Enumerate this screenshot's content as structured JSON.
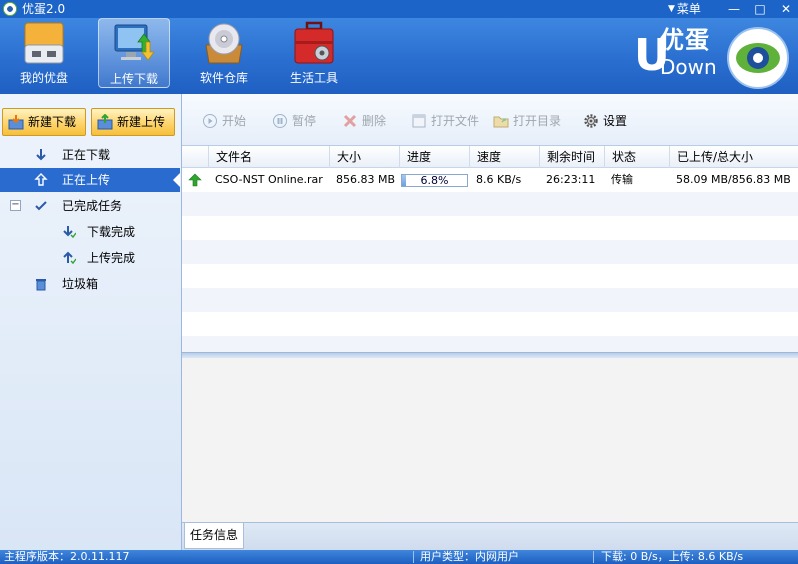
{
  "window": {
    "title": "优蛋2.0",
    "menu_label": "菜单",
    "minimize_glyph": "—",
    "maximize_glyph": "□",
    "close_glyph": "✕"
  },
  "topbar": {
    "tools": [
      {
        "label": "我的优盘",
        "icon": "usb-disk-icon"
      },
      {
        "label": "上传下载",
        "icon": "monitor-transfer-icon"
      },
      {
        "label": "软件仓库",
        "icon": "disc-box-icon"
      },
      {
        "label": "生活工具",
        "icon": "toolbox-icon"
      }
    ],
    "active_index": 1,
    "brand": {
      "letter": "U",
      "name": "优蛋",
      "sub": "Down"
    }
  },
  "sidebar": {
    "new_download": "新建下载",
    "new_upload": "新建上传",
    "items": [
      {
        "label": "正在下载",
        "icon": "arrow-down-icon"
      },
      {
        "label": "正在上传",
        "icon": "arrow-up-icon"
      },
      {
        "label": "已完成任务",
        "icon": "check-icon"
      },
      {
        "label": "下载完成",
        "icon": "download-done-icon"
      },
      {
        "label": "上传完成",
        "icon": "upload-done-icon"
      },
      {
        "label": "垃圾箱",
        "icon": "trash-icon"
      }
    ],
    "selected_index": 1,
    "expander_glyph": "−"
  },
  "toolbar": {
    "start": "开始",
    "pause": "暂停",
    "delete": "删除",
    "open_file": "打开文件",
    "open_dir": "打开目录",
    "settings": "设置"
  },
  "table": {
    "columns": [
      "文件名",
      "大小",
      "进度",
      "速度",
      "剩余时间",
      "状态",
      "已上传/总大小"
    ],
    "rows": [
      {
        "file": "CSO-NST Online.rar",
        "size": "856.83 MB",
        "progress_text": "6.8%",
        "progress": 0.068,
        "speed": "8.6 KB/s",
        "remaining": "26:23:11",
        "status": "传输",
        "transferred": "58.09 MB/856.83 MB"
      }
    ]
  },
  "bottom_tab": "任务信息",
  "statusbar": {
    "version": "主程序版本：2.0.11.117",
    "user_type": "用户类型：内网用户",
    "speeds": "下载: 0 B/s，上传: 8.6 KB/s"
  },
  "colors": {
    "titlebar": "#1c64c8",
    "selected_row": "#2a6bd0",
    "upload_arrow": "#2fa52f"
  }
}
